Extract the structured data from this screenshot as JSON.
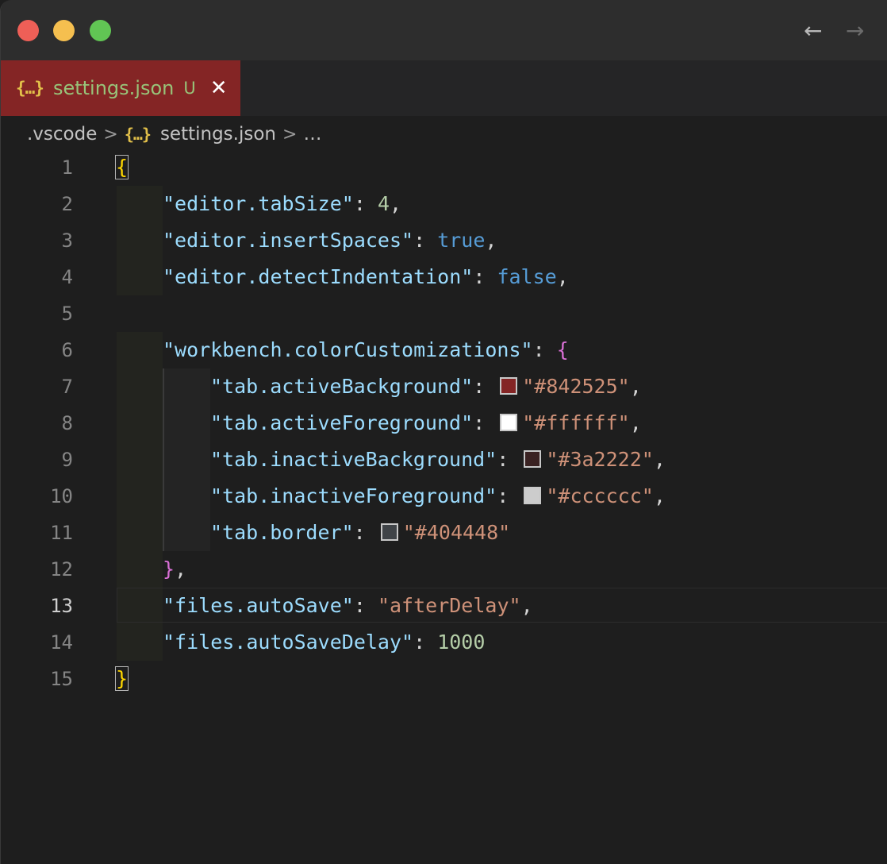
{
  "window": {
    "nav_back": "←",
    "nav_forward": "→"
  },
  "tab": {
    "icon": "{…}",
    "label": "settings.json",
    "badge": "U",
    "close": "✕",
    "background": "#842525"
  },
  "breadcrumb": {
    "folder": ".vscode",
    "separator": ">",
    "file_icon": "{…}",
    "file": "settings.json",
    "more": "…"
  },
  "editor": {
    "current_line": 13,
    "line_numbers": [
      "1",
      "2",
      "3",
      "4",
      "5",
      "6",
      "7",
      "8",
      "9",
      "10",
      "11",
      "12",
      "13",
      "14",
      "15"
    ],
    "lines": {
      "l1": {
        "open": "{"
      },
      "l2": {
        "key": "\"editor.tabSize\"",
        "colon": ": ",
        "value": "4",
        "comma": ","
      },
      "l3": {
        "key": "\"editor.insertSpaces\"",
        "colon": ": ",
        "value": "true",
        "comma": ","
      },
      "l4": {
        "key": "\"editor.detectIndentation\"",
        "colon": ": ",
        "value": "false",
        "comma": ","
      },
      "l6": {
        "key": "\"workbench.colorCustomizations\"",
        "colon": ": ",
        "open": "{"
      },
      "l7": {
        "key": "\"tab.activeBackground\"",
        "colon": ": ",
        "value": "\"#842525\"",
        "comma": ",",
        "swatch": "#842525"
      },
      "l8": {
        "key": "\"tab.activeForeground\"",
        "colon": ": ",
        "value": "\"#ffffff\"",
        "comma": ",",
        "swatch": "#ffffff"
      },
      "l9": {
        "key": "\"tab.inactiveBackground\"",
        "colon": ": ",
        "value": "\"#3a2222\"",
        "comma": ",",
        "swatch": "#3a2222"
      },
      "l10": {
        "key": "\"tab.inactiveForeground\"",
        "colon": ": ",
        "value": "\"#cccccc\"",
        "comma": ",",
        "swatch": "#cccccc"
      },
      "l11": {
        "key": "\"tab.border\"",
        "colon": ": ",
        "value": "\"#404448\"",
        "swatch": "#404448"
      },
      "l12": {
        "close": "}",
        "comma": ","
      },
      "l13": {
        "key": "\"files.autoSave\"",
        "colon": ": ",
        "value": "\"afterDelay\"",
        "comma": ","
      },
      "l14": {
        "key": "\"files.autoSaveDelay\"",
        "colon": ": ",
        "value": "1000"
      },
      "l15": {
        "close": "}"
      }
    }
  }
}
